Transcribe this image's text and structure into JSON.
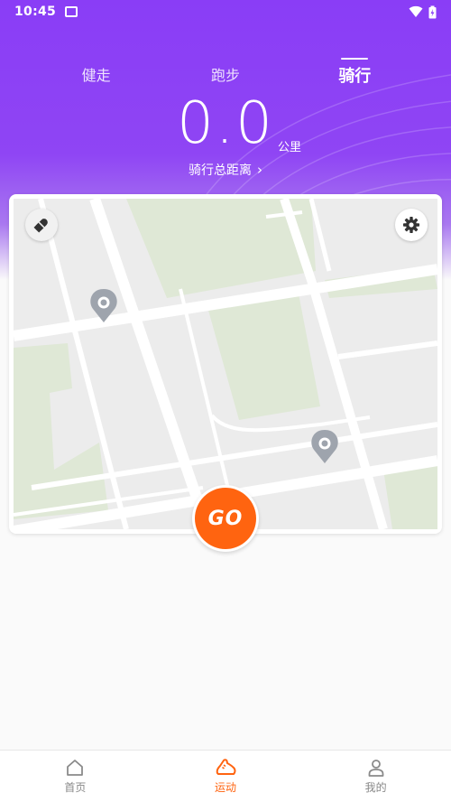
{
  "status_bar": {
    "time": "10:45"
  },
  "tabs": [
    {
      "label": "健走",
      "active": false
    },
    {
      "label": "跑步",
      "active": false
    },
    {
      "label": "骑行",
      "active": true
    }
  ],
  "summary": {
    "distance": "0.0",
    "unit": "公里",
    "label": "骑行总距离"
  },
  "go_button": {
    "label": "GO"
  },
  "bottom_nav": [
    {
      "label": "首页",
      "icon": "home-icon",
      "active": false
    },
    {
      "label": "运动",
      "icon": "shoe-icon",
      "active": true
    },
    {
      "label": "我的",
      "icon": "person-icon",
      "active": false
    }
  ],
  "colors": {
    "header_purple": "#8a3df6",
    "accent_orange": "#ff6410"
  }
}
